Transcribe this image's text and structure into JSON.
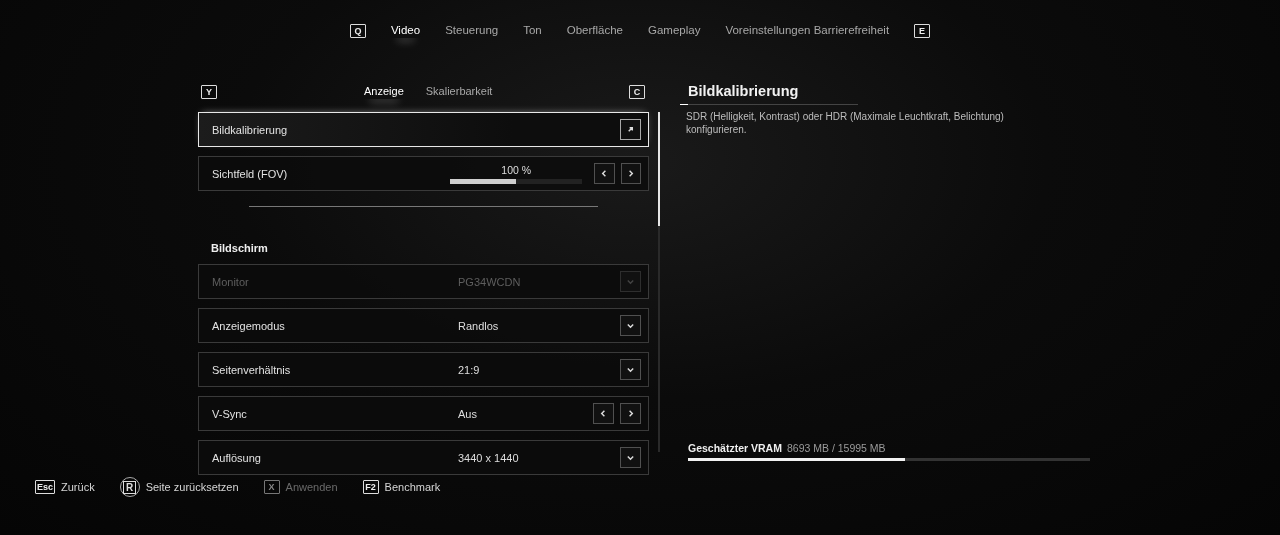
{
  "top_tabs": {
    "prev_key": "Q",
    "next_key": "E",
    "items": [
      {
        "label": "Video",
        "selected": true
      },
      {
        "label": "Steuerung",
        "selected": false
      },
      {
        "label": "Ton",
        "selected": false
      },
      {
        "label": "Oberfläche",
        "selected": false
      },
      {
        "label": "Gameplay",
        "selected": false
      },
      {
        "label": "Voreinstellungen Barrierefreiheit",
        "selected": false
      }
    ]
  },
  "sub_tabs": {
    "prev_key": "Y",
    "next_key": "C",
    "items": [
      {
        "label": "Anzeige",
        "selected": true
      },
      {
        "label": "Skalierbarkeit",
        "selected": false
      }
    ]
  },
  "settings": [
    {
      "kind": "link",
      "label": "Bildkalibrierung",
      "selected": true,
      "disabled": false
    },
    {
      "kind": "slider",
      "label": "Sichtfeld (FOV)",
      "value": "100 %",
      "level": 0.5,
      "selected": false,
      "disabled": false
    },
    {
      "kind": "separator"
    },
    {
      "kind": "header",
      "label": "Bildschirm"
    },
    {
      "kind": "dropdown",
      "label": "Monitor",
      "value": "PG34WCDN",
      "selected": false,
      "disabled": true
    },
    {
      "kind": "dropdown",
      "label": "Anzeigemodus",
      "value": "Randlos",
      "selected": false,
      "disabled": false
    },
    {
      "kind": "dropdown",
      "label": "Seitenverhältnis",
      "value": "21:9",
      "selected": false,
      "disabled": false
    },
    {
      "kind": "stepper",
      "label": "V-Sync",
      "value": "Aus",
      "selected": false,
      "disabled": false
    },
    {
      "kind": "dropdown",
      "label": "Auflösung",
      "value": "3440 x 1440",
      "selected": false,
      "disabled": false
    }
  ],
  "details": {
    "title": "Bildkalibrierung",
    "description": "SDR (Helligkeit, Kontrast) oder HDR (Maximale Leuchtkraft, Belichtung) konfigurieren."
  },
  "vram": {
    "label": "Geschätzter VRAM",
    "value": "8693 MB / 15995 MB",
    "level": 0.54
  },
  "footer": [
    {
      "kind": "key",
      "key": "Esc",
      "label": "Zurück",
      "disabled": false
    },
    {
      "kind": "circle",
      "key": "R",
      "label": "Seite zurücksetzen",
      "disabled": false
    },
    {
      "kind": "key",
      "key": "X",
      "label": "Anwenden",
      "disabled": true
    },
    {
      "kind": "key",
      "key": "F2",
      "label": "Benchmark",
      "disabled": false
    }
  ]
}
